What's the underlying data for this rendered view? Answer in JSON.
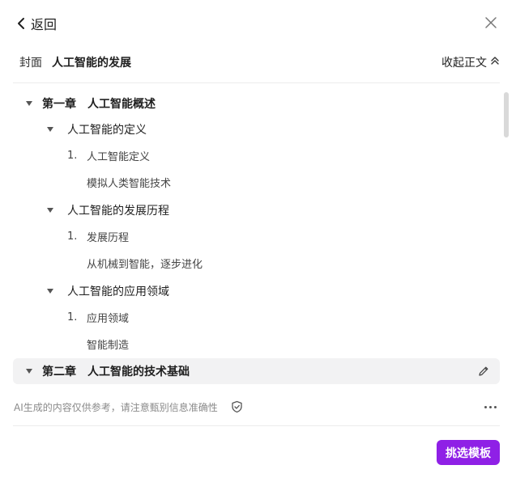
{
  "header": {
    "back_label": "返回"
  },
  "cover": {
    "label": "封面",
    "title": "人工智能的发展",
    "collapse_label": "收起正文"
  },
  "outline": {
    "chapters": [
      {
        "label": "第一章",
        "title": "人工智能概述",
        "sections": [
          {
            "title": "人工智能的定义",
            "item_num": "1.",
            "item_title": "人工智能定义",
            "item_text": "模拟人类智能技术"
          },
          {
            "title": "人工智能的发展历程",
            "item_num": "1.",
            "item_title": "发展历程",
            "item_text": "从机械到智能，逐步进化"
          },
          {
            "title": "人工智能的应用领域",
            "item_num": "1.",
            "item_title": "应用领域",
            "item_text": "智能制造"
          }
        ]
      },
      {
        "label": "第二章",
        "title": "人工智能的技术基础"
      }
    ]
  },
  "footer": {
    "disclaimer": "AI生成的内容仅供参考，请注意甄别信息准确性",
    "pick_template_label": "挑选模板"
  },
  "colors": {
    "accent": "#8f20e6",
    "highlight_row": "#f2f2f3"
  }
}
